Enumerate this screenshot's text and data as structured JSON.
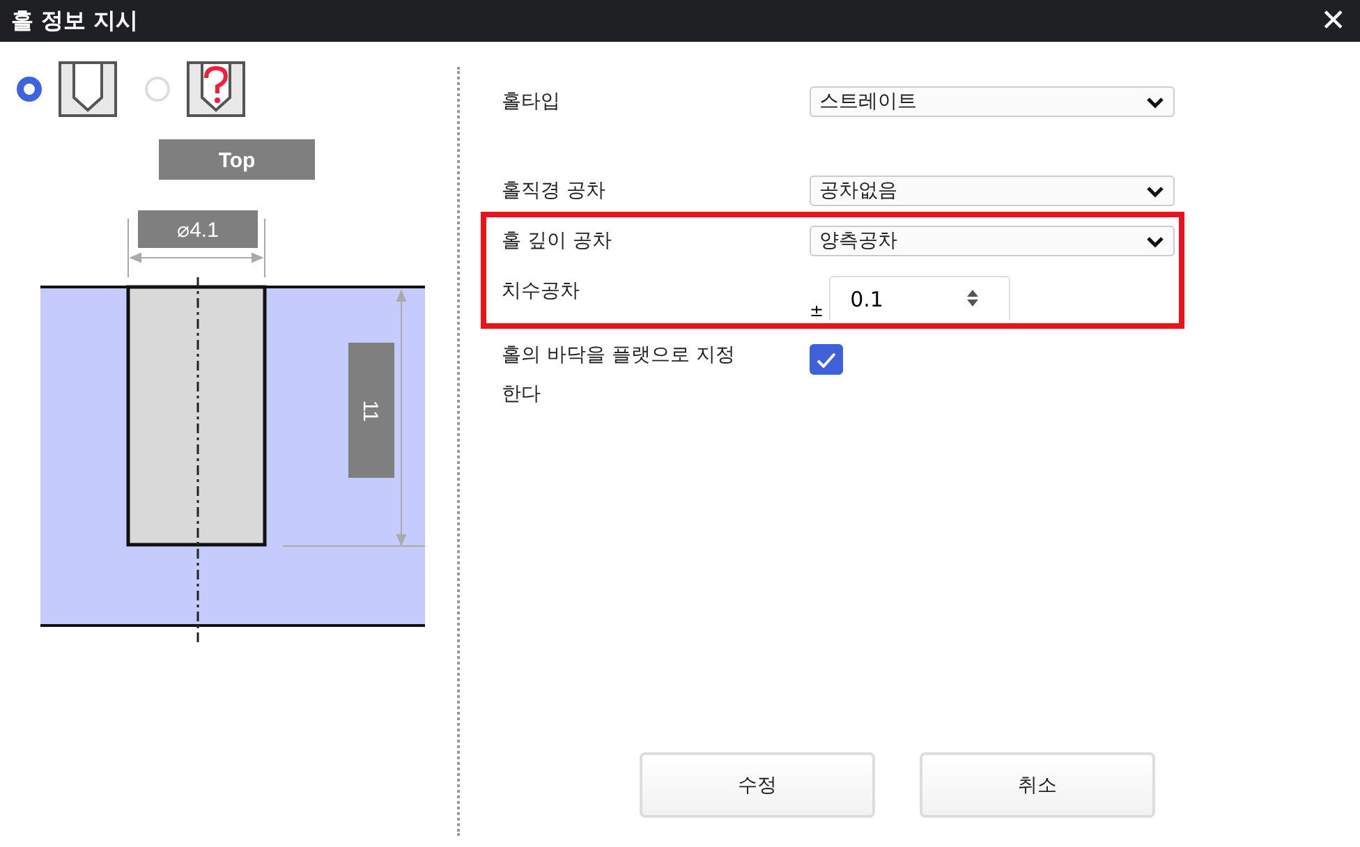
{
  "window": {
    "title": "홀 정보 지시",
    "close": "✕"
  },
  "hole_modes": [
    {
      "kind": "known",
      "selected": true
    },
    {
      "kind": "unknown",
      "selected": false
    }
  ],
  "diagram": {
    "view_label": "Top",
    "diameter": "⌀4.1",
    "depth": "11"
  },
  "fields": [
    {
      "kind": "select",
      "label": "홀타입",
      "value": "스트레이트",
      "highlighted": false
    },
    {
      "kind": "select",
      "label": "홀직경 공차",
      "value": "공차없음",
      "highlighted": false
    },
    {
      "kind": "select",
      "label": "홀 깊이 공차",
      "value": "양측공차",
      "highlighted": true
    },
    {
      "kind": "number",
      "label": "치수공차",
      "prefix": "±",
      "value": "0.1",
      "highlighted": true
    },
    {
      "kind": "checkbox",
      "label": "홀의 바닥을 플랫으로 지정한다",
      "checked": true,
      "highlighted": false
    }
  ],
  "buttons": [
    "수정",
    "취소"
  ]
}
